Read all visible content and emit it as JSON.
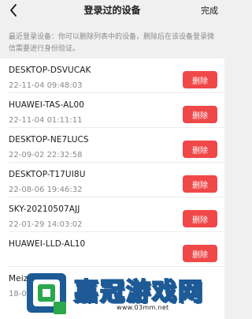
{
  "nav": {
    "title": "登录过的设备",
    "done_label": "完成"
  },
  "description": "最近登录设备：你可以删除列表中的设备，删除后在该设备登录微信需要进行身份验证。",
  "devices": [
    {
      "name": "DESKTOP-DSVUCAK",
      "time": "22-11-04 09:48:03",
      "delete_label": "删除"
    },
    {
      "name": "HUAWEI-TAS-AL00",
      "time": "22-11-04 01:11:11",
      "delete_label": "删除"
    },
    {
      "name": "DESKTOP-NE7LUCS",
      "time": "22-09-02 22:32:58",
      "delete_label": "删除"
    },
    {
      "name": "DESKTOP-T17UI8U",
      "time": "22-08-06 19:46:32",
      "delete_label": "删除"
    },
    {
      "name": "SKY-20210507AJJ",
      "time": "22-01-29 14:03:02",
      "delete_label": "删除"
    },
    {
      "name": "HUAWEI-LLD-AL10",
      "time": "",
      "delete_label": "删除"
    },
    {
      "name": "Meiz",
      "time": "18-0",
      "delete_label": ""
    }
  ],
  "watermark": {
    "brand": "嘉冠游戏网",
    "url": "www.03mm.net"
  },
  "colors": {
    "delete_button": "#f04848",
    "watermark_blue": "#1d5a96",
    "watermark_green": "#2aa84a"
  }
}
